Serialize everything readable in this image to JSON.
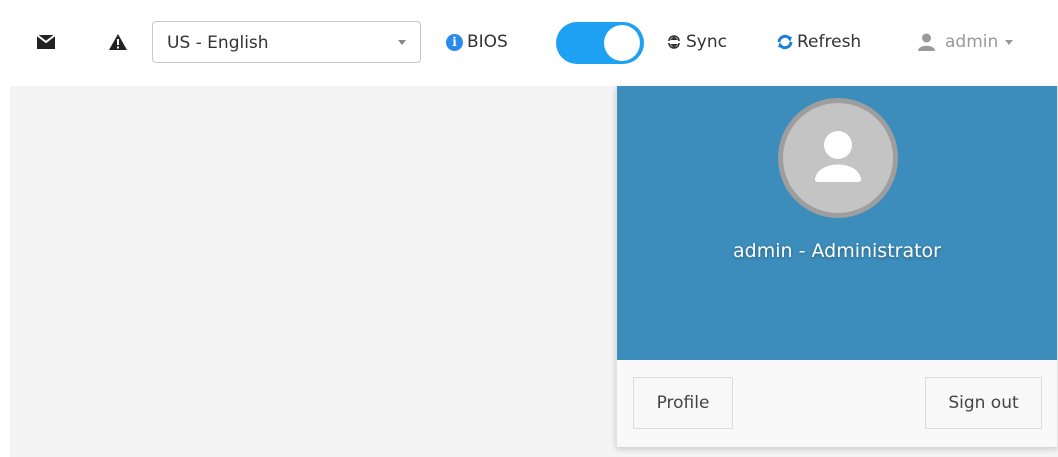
{
  "toolbar": {
    "language": {
      "selected": "US - English"
    },
    "bios_label": "BIOS",
    "bios_toggle_on": true,
    "sync_label": "Sync",
    "refresh_label": "Refresh",
    "user_label": "admin"
  },
  "user_dropdown": {
    "title": "admin - Administrator",
    "profile_label": "Profile",
    "signout_label": "Sign out"
  },
  "icons": {
    "envelope": "envelope-icon",
    "warning": "warning-icon",
    "info": "info-icon",
    "sync": "sync-icon",
    "refresh": "refresh-icon",
    "user": "user-icon",
    "caret": "chevron-down-icon",
    "avatar": "user-avatar-icon"
  },
  "colors": {
    "accent": "#1ea1f3",
    "header_bg": "#3c8dbc",
    "refresh_blue": "#1a7fd6",
    "info_blue": "#2a8be8"
  }
}
